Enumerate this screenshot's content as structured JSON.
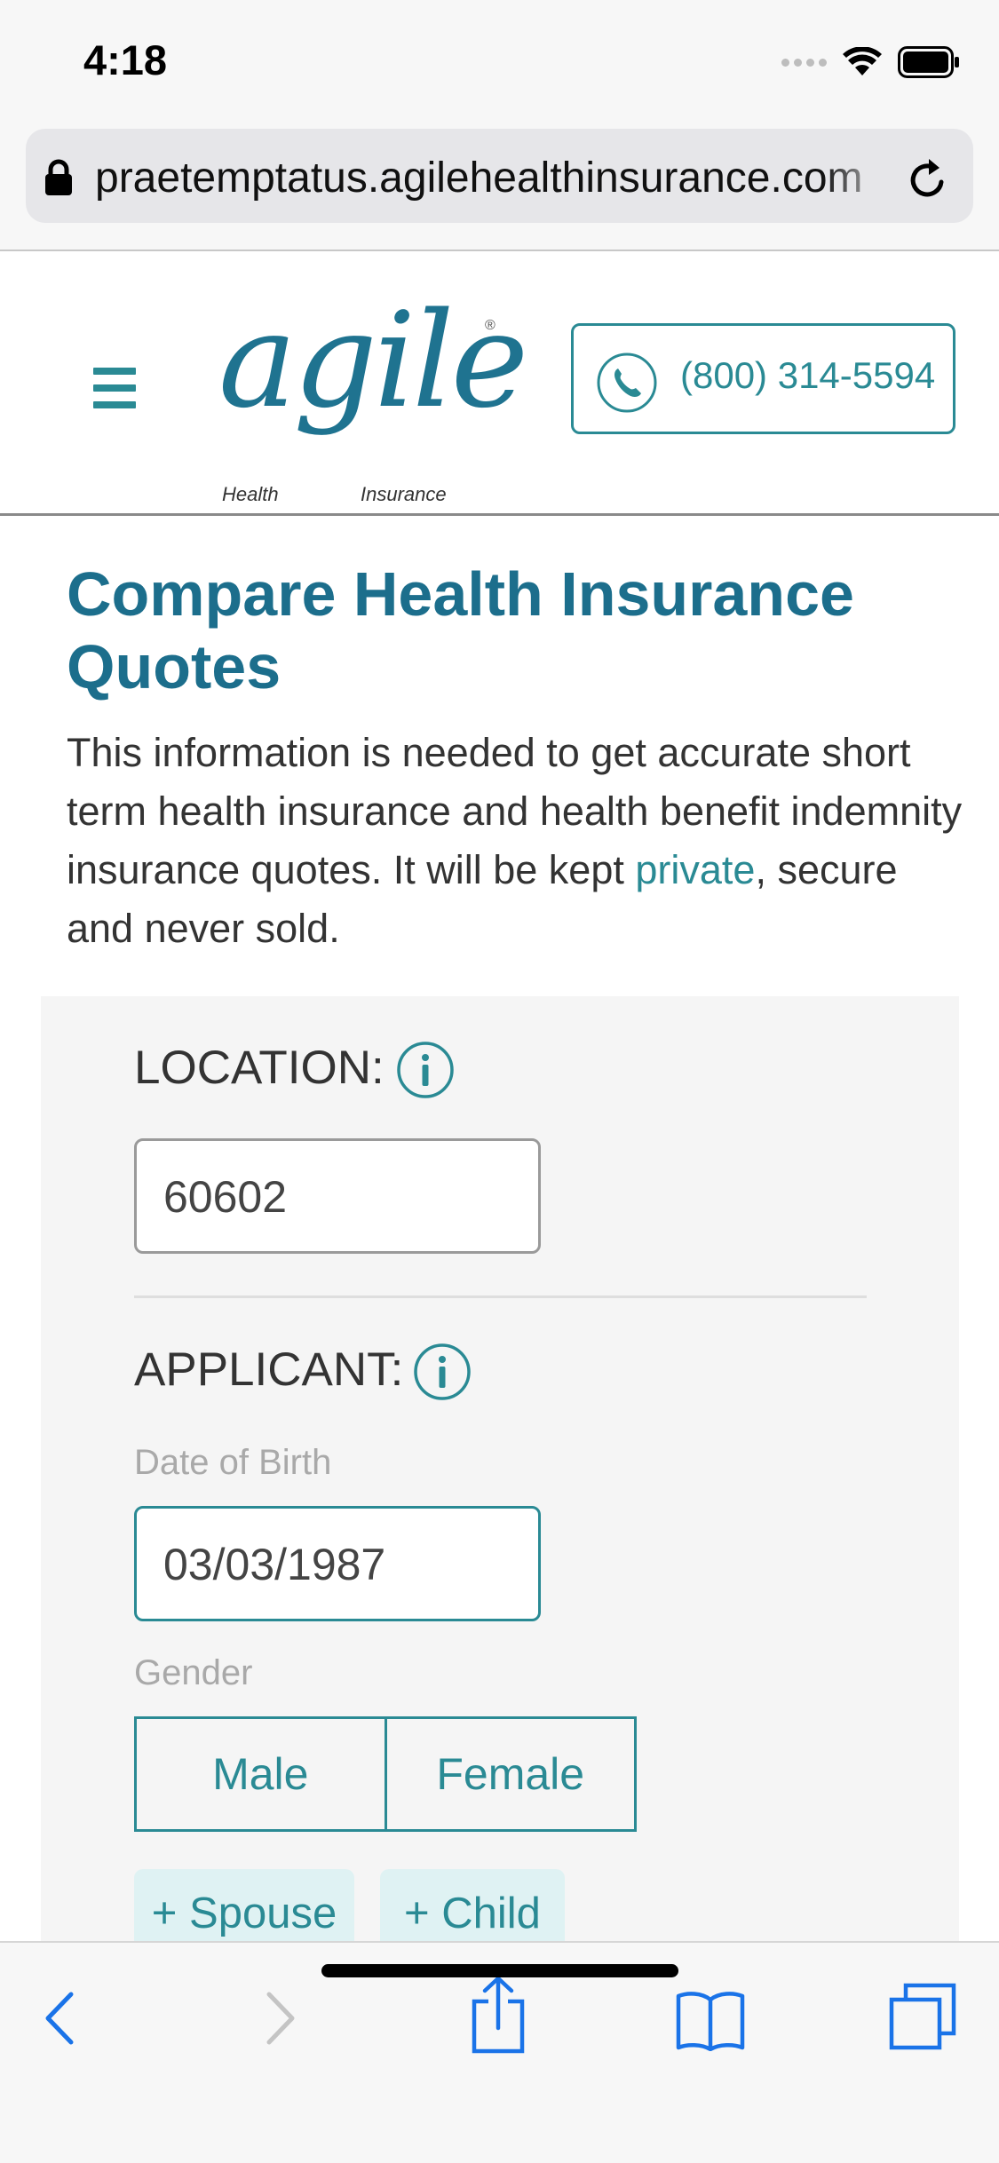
{
  "status_bar": {
    "time": "4:18",
    "icons": [
      "cellular-signal-icon",
      "wifi-icon",
      "battery-icon"
    ]
  },
  "browser": {
    "url": "praetemptatus.agilehealthinsurance.com",
    "lock_icon": "lock-icon",
    "reload_icon": "reload-icon"
  },
  "header": {
    "menu_icon": "hamburger-menu-icon",
    "logo": {
      "word": "agile",
      "registered_mark": "®",
      "sub_left": "Health",
      "sub_right": "Insurance"
    },
    "phone": {
      "icon": "phone-icon",
      "number": "(800) 314-5594"
    }
  },
  "main": {
    "title": "Compare Health Insurance Quotes",
    "intro_before_link": "This information is needed to get accurate short term health insurance and health benefit indemnity insurance quotes. It will be kept ",
    "intro_link": "private",
    "intro_after_link": ", secure and never sold."
  },
  "form": {
    "location": {
      "label": "LOCATION:",
      "info_icon": "info-icon",
      "value": "60602"
    },
    "applicant": {
      "label": "APPLICANT:",
      "info_icon": "info-icon",
      "dob_caption": "Date of Birth",
      "dob_value": "03/03/1987",
      "gender_caption": "Gender",
      "gender_options": [
        "Male",
        "Female"
      ]
    },
    "add_spouse": "+ Spouse",
    "add_child": "+ Child"
  },
  "toolbar": {
    "items": [
      "back-icon",
      "forward-icon",
      "share-icon",
      "bookmarks-icon",
      "tabs-icon"
    ]
  },
  "colors": {
    "teal": "#2a8a94",
    "title_blue": "#1c6e8c",
    "panel_bg": "#f5f5f5"
  }
}
